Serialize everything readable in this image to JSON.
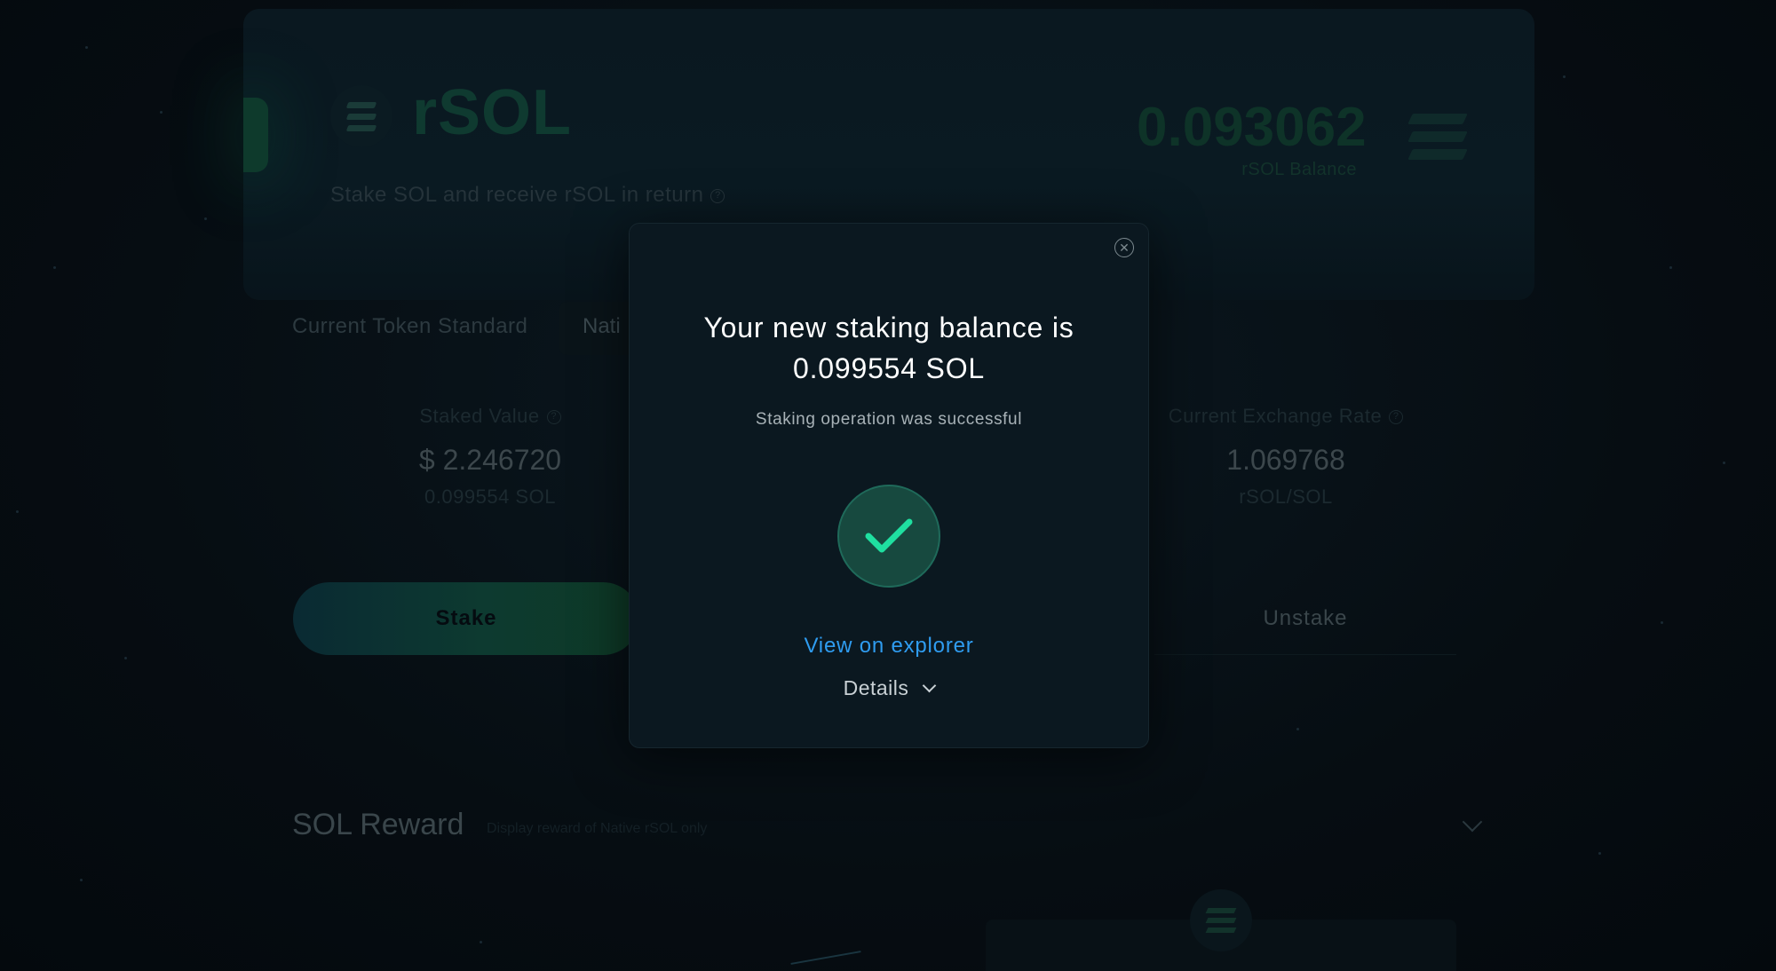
{
  "hero": {
    "token_name": "rSOL",
    "subtitle": "Stake SOL and receive rSOL in return",
    "balance_value": "0.093062",
    "balance_label": "rSOL Balance"
  },
  "token_standard": {
    "label": "Current Token Standard",
    "selected_tab": "Nati"
  },
  "stats": {
    "staked_value": {
      "label": "Staked Value",
      "value": "$ 2.246720",
      "sub": "0.099554 SOL"
    },
    "exchange_rate": {
      "label": "Current Exchange Rate",
      "value": "1.069768",
      "sub": "rSOL/SOL"
    }
  },
  "actions": {
    "stake_label": "Stake",
    "unstake_label": "Unstake"
  },
  "reward": {
    "title": "SOL Reward",
    "note": "Display reward of Native rSOL only"
  },
  "modal": {
    "title_line1": "Your new staking balance is",
    "title_line2": "0.099554 SOL",
    "subtitle": "Staking operation was successful",
    "explorer_link": "View on explorer",
    "details_label": "Details",
    "close_glyph": "✕"
  },
  "colors": {
    "accent_green": "#1fe0a0",
    "link_blue": "#2f9cf0",
    "modal_bg": "#0b1820"
  }
}
